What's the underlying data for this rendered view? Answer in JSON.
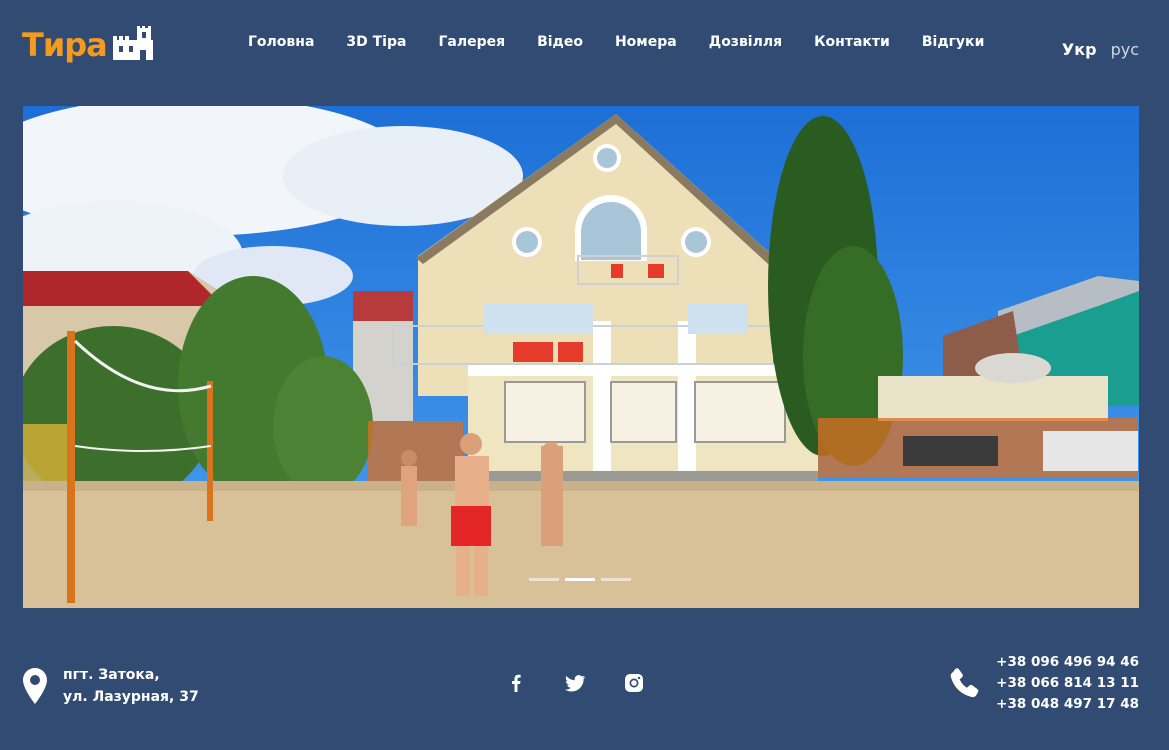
{
  "brand": {
    "logo_text": "Тира"
  },
  "nav": [
    {
      "label": "Головна",
      "active": true
    },
    {
      "label": "3D Тіра",
      "active": false
    },
    {
      "label": "Галерея",
      "active": false
    },
    {
      "label": "Відео",
      "active": false
    },
    {
      "label": "Номера",
      "active": false
    },
    {
      "label": "Дозвілля",
      "active": false
    },
    {
      "label": "Контакти",
      "active": false
    },
    {
      "label": "Відгуки",
      "active": false
    }
  ],
  "lang": {
    "current": "Укр",
    "alt": "рус"
  },
  "slider": {
    "total": 3,
    "active_index": 2
  },
  "footer": {
    "address_line1": "пгт. Затока,",
    "address_line2": "ул. Лазурная, 37",
    "social": [
      "facebook-icon",
      "twitter-icon",
      "instagram-icon"
    ],
    "phones": [
      "+38 096 496 94 46",
      "+38 066 814 13 11",
      "+38 048 497 17 48"
    ]
  },
  "colors": {
    "background": "#324b72",
    "brand": "#f39a1f"
  }
}
